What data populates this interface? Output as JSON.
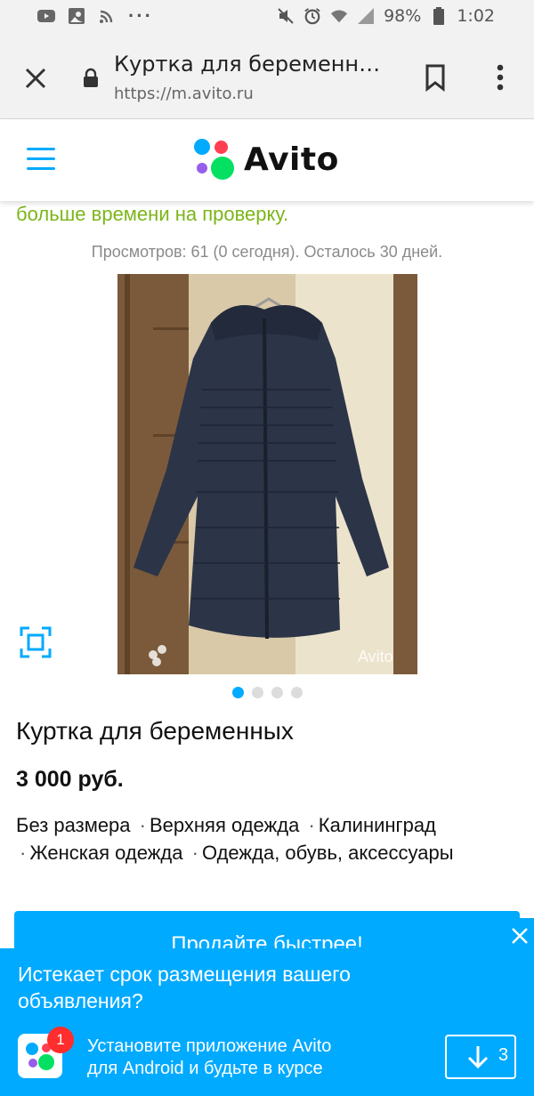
{
  "status_bar": {
    "battery": "98%",
    "time": "1:02",
    "left_icons": [
      "youtube-icon",
      "gallery-icon",
      "cast-icon",
      "more-icon"
    ],
    "right_icons": [
      "mute-icon",
      "alarm-icon",
      "wifi-icon",
      "signal-icon",
      "battery-icon"
    ]
  },
  "browser": {
    "tab_title": "Куртка для беременн…",
    "url": "https://m.avito.ru"
  },
  "header": {
    "logo_text": "Avito",
    "logo_colors": [
      "#00aaff",
      "#ff4053",
      "#965eeb",
      "#04e061"
    ]
  },
  "listing": {
    "partial_notice": "больше времени на проверку.",
    "views": "Просмотров: 61 (0 сегодня). Осталось 30 дней.",
    "photo_watermark": "Avito",
    "photo_count": 4,
    "active_photo": 1,
    "title": "Куртка для беременных",
    "price": "3 000 руб.",
    "params": [
      "Без размера",
      "Верхняя одежда",
      "Калининград",
      "Женская одежда",
      "Одежда, обувь, аксессуары"
    ],
    "param_separator": "·",
    "sell_faster": "Продайте быстрее!"
  },
  "banner": {
    "title": "Истекает срок размещения вашего объявления?",
    "install_line1": "Установите приложение Avito",
    "install_line2": "для Android и будьте в курсе",
    "badge": "1",
    "download_count": "3"
  },
  "colors": {
    "accent": "#00aaff",
    "green_text": "#7cb518",
    "badge_red": "#ff2d2d"
  }
}
